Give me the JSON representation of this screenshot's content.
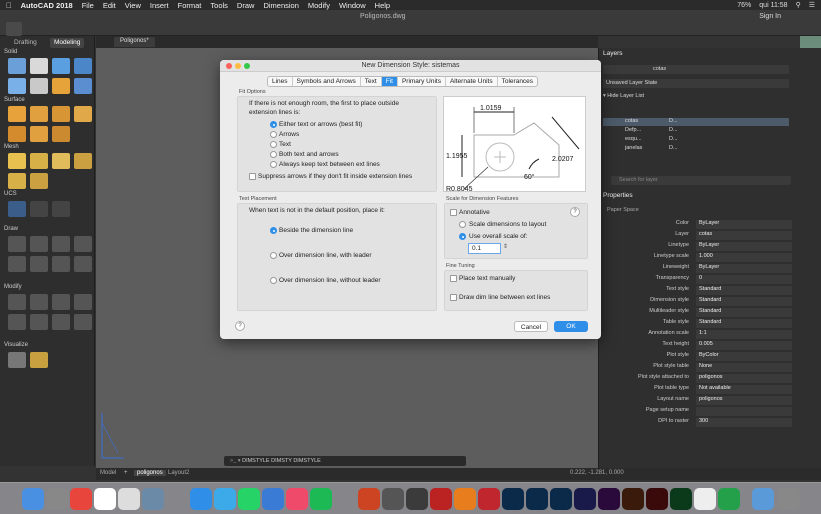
{
  "menubar": {
    "apple": "",
    "app": "AutoCAD 2018",
    "items": [
      "File",
      "Edit",
      "View",
      "Insert",
      "Format",
      "Tools",
      "Draw",
      "Dimension",
      "Modify",
      "Window",
      "Help"
    ],
    "battery": "76%",
    "clock": "qui 11:58"
  },
  "titlebar": {
    "doc_title": "Poligonos.dwg",
    "signin": "Sign In"
  },
  "left_palette": {
    "tabs": [
      "Drafting",
      "Modeling"
    ],
    "sections": [
      "Solid",
      "Surface",
      "Mesh",
      "UCS",
      "Draw",
      "Modify",
      "Visualize"
    ]
  },
  "doc_tab": "Poligonos*",
  "layout_tabs": [
    "Model",
    "poligonos",
    "Layout2"
  ],
  "command_line": "DIMSTYLE DIMSTY DIMSTYLE",
  "coords": "0.222, -1.281, 0.000",
  "layers_panel": {
    "title": "Layers",
    "current": "cotas",
    "state": "Unsaved Layer State",
    "hide_label": "Hide Layer List",
    "rows": [
      {
        "name": "cotas",
        "mark": "D..."
      },
      {
        "name": "Defp...",
        "mark": "D..."
      },
      {
        "name": "esqu...",
        "mark": "D..."
      },
      {
        "name": "janelas",
        "mark": "D..."
      }
    ],
    "search_placeholder": "Search for layer"
  },
  "properties": {
    "title": "Properties",
    "sub": "Paper Space",
    "rows": [
      {
        "k": "Color",
        "v": "ByLayer"
      },
      {
        "k": "Layer",
        "v": "cotas"
      },
      {
        "k": "Linetype",
        "v": "ByLayer"
      },
      {
        "k": "Linetype scale",
        "v": "1.000"
      },
      {
        "k": "Lineweight",
        "v": "ByLayer"
      },
      {
        "k": "Transparency",
        "v": "0"
      },
      {
        "k": "Text style",
        "v": "Standard"
      },
      {
        "k": "Dimension style",
        "v": "Standard"
      },
      {
        "k": "Multileader style",
        "v": "Standard"
      },
      {
        "k": "Table style",
        "v": "Standard"
      },
      {
        "k": "Annotation scale",
        "v": "1:1"
      },
      {
        "k": "Text height",
        "v": "0.005"
      },
      {
        "k": "Plot style",
        "v": "ByColor"
      },
      {
        "k": "Plot style table",
        "v": "None"
      },
      {
        "k": "Plot style attached to",
        "v": "poligonos"
      },
      {
        "k": "Plot table type",
        "v": "Not available"
      },
      {
        "k": "Layout name",
        "v": "poligonos"
      },
      {
        "k": "Page setup name",
        "v": ""
      },
      {
        "k": "DPI to raster",
        "v": "300"
      }
    ]
  },
  "dialog": {
    "title": "New Dimension Style: sistemas",
    "tabs": [
      "Lines",
      "Symbols and Arrows",
      "Text",
      "Fit",
      "Primary Units",
      "Alternate Units",
      "Tolerances"
    ],
    "selected_tab": "Fit",
    "fit_options": {
      "label": "Fit Options",
      "intro": "If there is not enough room, the first to place outside",
      "intro2": "extension lines is:",
      "options": [
        "Either text or arrows (best fit)",
        "Arrows",
        "Text",
        "Both text and arrows",
        "Always keep text between ext lines"
      ],
      "selected": "Either text or arrows (best fit)",
      "suppress": "Suppress arrows if they don't fit inside extension lines"
    },
    "preview": {
      "d1": "1.0159",
      "d2": "1.1955",
      "d3": "2.0207",
      "angle": "60°",
      "radius": "R0.8045"
    },
    "text_placement": {
      "label": "Text Placement",
      "intro": "When text is not in the default position, place it:",
      "options": [
        "Beside the dimension line",
        "Over dimension line, with leader",
        "Over dimension line, without leader"
      ],
      "selected": "Beside the dimension line"
    },
    "scale": {
      "label": "Scale for Dimension Features",
      "annotative": "Annotative",
      "to_layout": "Scale dimensions to layout",
      "overall": "Use overall scale of:",
      "value": "0.1"
    },
    "fine_tuning": {
      "label": "Fine Tuning",
      "manual": "Place text manually",
      "drawdim": "Draw dim line between ext lines"
    },
    "help": "?",
    "cancel": "Cancel",
    "ok": "OK"
  }
}
